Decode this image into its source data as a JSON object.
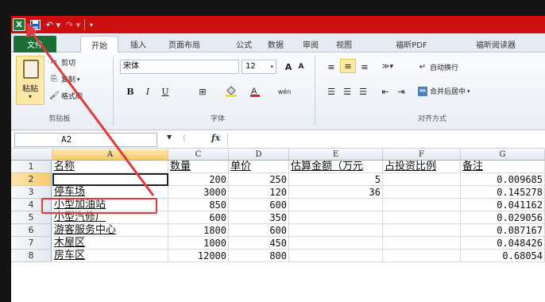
{
  "app": {
    "logo": "X",
    "title_bar_color": "#cc0e0e"
  },
  "qat": {
    "save_icon": "save-icon",
    "undo_glyph": "↶ ▾",
    "redo_glyph": "↷ ▾",
    "more_glyph": "▾"
  },
  "tabs": [
    "文件",
    "开始",
    "插入",
    "页面布局",
    "公式",
    "数据",
    "审阅",
    "视图",
    "福昕PDF",
    "福昕阅读器"
  ],
  "ribbon": {
    "paste": "粘贴",
    "cut": "剪切",
    "copy": "复制",
    "format_painter": "格式刷",
    "clipboard_group": "剪贴板",
    "font_name": "宋体",
    "font_size": "12",
    "grow_font": "A",
    "shrink_font": "A",
    "bold": "B",
    "italic": "I",
    "underline": "U",
    "phonetic": "wén",
    "font_group": "字体",
    "wrap_text": "自动换行",
    "merge_center": "合并后居中",
    "alignment_group": "对齐方式"
  },
  "formula_bar": {
    "name_box": "A2",
    "fx": "fx",
    "formula": ""
  },
  "columns": [
    "A",
    "C",
    "D",
    "E",
    "F",
    "G"
  ],
  "rows": [
    {
      "n": "1",
      "a": "名称",
      "c": "数量",
      "d": "单价",
      "e": "估算金额（万元",
      "f": "占投资比例",
      "g": "备注"
    },
    {
      "n": "2",
      "a": "",
      "c": "200",
      "d": "250",
      "e": "5",
      "f": "",
      "g": "0.009685"
    },
    {
      "n": "3",
      "a": "停车场",
      "c": "3000",
      "d": "120",
      "e": "36",
      "f": "",
      "g": "0.145278"
    },
    {
      "n": "4",
      "a": "小型加油站",
      "c": "850",
      "d": "600",
      "e": "",
      "f": "",
      "g": "0.041162"
    },
    {
      "n": "5",
      "a": "小型汽修厂",
      "c": "600",
      "d": "350",
      "e": "",
      "f": "",
      "g": "0.029056"
    },
    {
      "n": "6",
      "a": "游客服务中心",
      "c": "1800",
      "d": "600",
      "e": "",
      "f": "",
      "g": "0.087167"
    },
    {
      "n": "7",
      "a": "木屋区",
      "c": "1000",
      "d": "450",
      "e": "",
      "f": "",
      "g": "0.048426"
    },
    {
      "n": "8",
      "a": "房车区",
      "c": "12000",
      "d": "800",
      "e": "",
      "f": "",
      "g": "0.68054"
    }
  ],
  "colors": {
    "file_tab": "#1a6e33",
    "annotation": "#e03a3a"
  }
}
